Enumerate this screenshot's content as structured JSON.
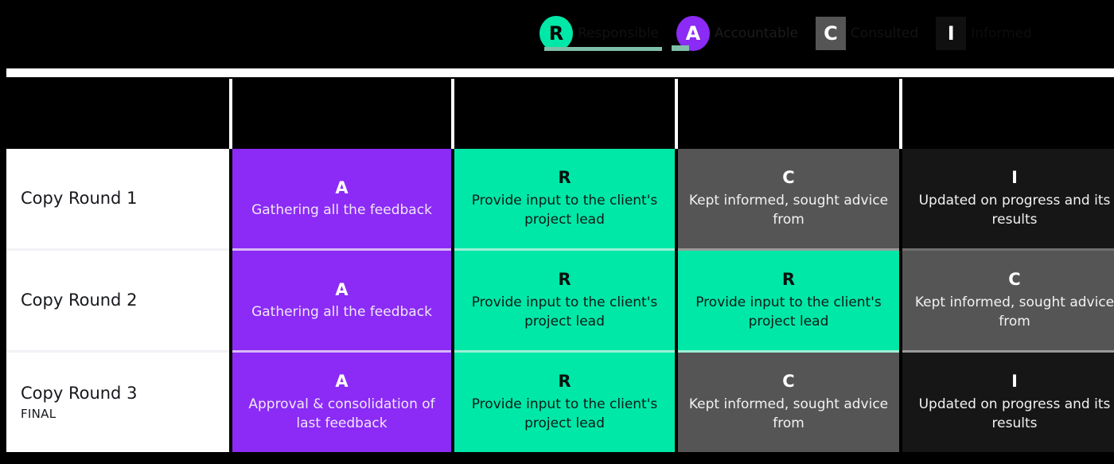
{
  "legend": {
    "items": [
      {
        "key": "R",
        "label": "Responsible",
        "color": "#00e8a8",
        "shape": "circle"
      },
      {
        "key": "A",
        "label": "Accountable",
        "color": "#8b2bf5",
        "shape": "circle"
      },
      {
        "key": "C",
        "label": "Consulted",
        "color": "#555555",
        "shape": "square"
      },
      {
        "key": "I",
        "label": "Informed",
        "color": "#101010",
        "shape": "square"
      }
    ]
  },
  "matrix": {
    "headers": [
      "",
      "",
      "",
      "",
      ""
    ],
    "rows": [
      {
        "label": "Copy Round 1",
        "sublabel": "",
        "cells": [
          {
            "letter": "A",
            "desc": "Gathering all the feedback",
            "type": "A"
          },
          {
            "letter": "R",
            "desc": "Provide input to the client's project lead",
            "type": "R"
          },
          {
            "letter": "C",
            "desc": "Kept informed, sought advice from",
            "type": "C"
          },
          {
            "letter": "I",
            "desc": "Updated on progress and its results",
            "type": "I"
          }
        ]
      },
      {
        "label": "Copy Round 2",
        "sublabel": "",
        "cells": [
          {
            "letter": "A",
            "desc": "Gathering all the feedback",
            "type": "A"
          },
          {
            "letter": "R",
            "desc": "Provide input to the client's project lead",
            "type": "R"
          },
          {
            "letter": "R",
            "desc": "Provide input to the client's project lead",
            "type": "R"
          },
          {
            "letter": "C",
            "desc": "Kept informed, sought advice from",
            "type": "C"
          }
        ]
      },
      {
        "label": "Copy Round 3",
        "sublabel": "FINAL",
        "cells": [
          {
            "letter": "A",
            "desc": "Approval & consolidation of last feedback",
            "type": "A"
          },
          {
            "letter": "R",
            "desc": "Provide input to the client's project lead",
            "type": "R"
          },
          {
            "letter": "C",
            "desc": "Kept informed, sought advice from",
            "type": "C"
          },
          {
            "letter": "I",
            "desc": "Updated on progress and its results",
            "type": "I"
          }
        ]
      }
    ]
  }
}
